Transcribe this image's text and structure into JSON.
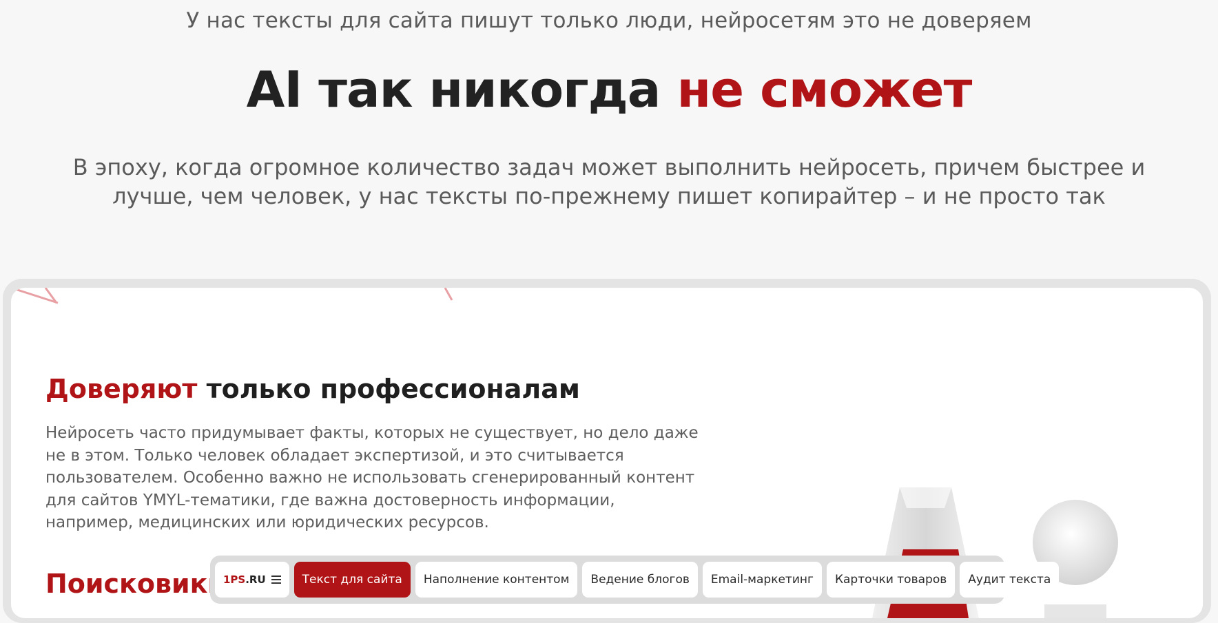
{
  "hero": {
    "kicker": "У нас тексты для сайта пишут только люди, нейросетям это не доверяем",
    "title_main": "AI так никогда ",
    "title_accent": "не сможет",
    "lead": "В эпоху, когда огромное количество задач может выполнить нейросеть, причем быстрее и лучше, чем человек, у нас тексты по-прежнему пишет копирайтер – и не просто так"
  },
  "card": {
    "title_accent": "Доверяют",
    "title_rest": " только профессионалам",
    "text": "Нейросеть часто придумывает факты, которых не существует, но дело даже не в этом. Только человек обладает экспертизой, и это считывается пользователем. Особенно важно не использовать сгенерированный контент для сайтов YMYL-тематики, где важна достоверность информации, например, медицинских или юридических ресурсов.",
    "title2": "Поисковики"
  },
  "bottom_bar": {
    "logo_accent": "1PS",
    "logo_rest": ".RU",
    "menu_icon": "menu-icon",
    "items": [
      {
        "label": "Текст для сайта",
        "active": true
      },
      {
        "label": "Наполнение контентом",
        "active": false
      },
      {
        "label": "Ведение блогов",
        "active": false
      },
      {
        "label": "Email-маркетинг",
        "active": false
      },
      {
        "label": "Карточки товаров",
        "active": false
      },
      {
        "label": "Аудит текста",
        "active": false
      }
    ]
  },
  "colors": {
    "accent": "#b11416",
    "background": "#f7f7f7",
    "card": "#ffffff",
    "frame": "#e4e4e4",
    "text_muted": "#5e5e5e"
  }
}
